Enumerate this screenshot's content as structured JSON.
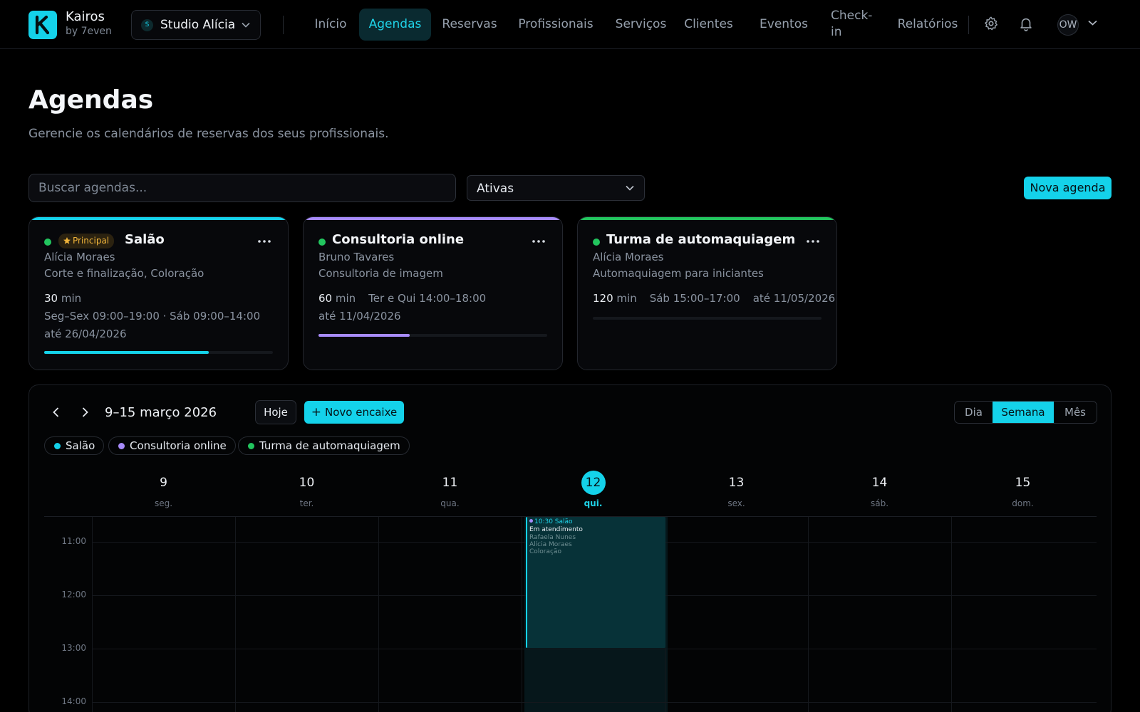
{
  "brand": {
    "name": "Kairos",
    "sub": "by 7even"
  },
  "workspace": {
    "initial": "S",
    "name": "Studio Alícia"
  },
  "nav": {
    "inicio": "Início",
    "agendas": "Agendas",
    "reservas": "Reservas",
    "profissionais": "Profissionais",
    "servicos": "Serviços",
    "clientes": "Clientes",
    "eventos": "Eventos",
    "checkin_1": "Check-",
    "checkin_2": "in",
    "relatorios": "Relatórios"
  },
  "user": {
    "initials": "OW"
  },
  "page": {
    "title": "Agendas",
    "subtitle": "Gerencie os calendários de reservas dos seus profissionais."
  },
  "filters": {
    "search_placeholder": "Buscar agendas...",
    "status_value": "Ativas",
    "new_button": "Nova agenda"
  },
  "cards": [
    {
      "accent": "#14d2ea",
      "badge": "Principal",
      "title": "Salão",
      "professional": "Alícia Moraes",
      "services": "Corte e finalização, Coloração",
      "duration": "30",
      "duration_unit": "min",
      "schedule": "Seg–Sex 09:00–19:00 · Sáb 09:00–14:00",
      "until": "até 26/04/2026",
      "progress": 0.72
    },
    {
      "accent": "#a78bfa",
      "title": "Consultoria online",
      "professional": "Bruno Tavares",
      "services": "Consultoria de imagem",
      "duration": "60",
      "duration_unit": "min",
      "schedule": "Ter e Qui 14:00–18:00",
      "until": "até 11/04/2026",
      "progress": 0.4
    },
    {
      "accent": "#22c55e",
      "title": "Turma de automaquiagem",
      "professional": "Alícia Moraes",
      "services": "Automaquiagem para iniciantes",
      "duration": "120",
      "duration_unit": "min",
      "schedule": "Sáb 15:00–17:00",
      "until": "até 11/05/2026",
      "progress": 0
    }
  ],
  "calendar": {
    "range": "9–15 março 2026",
    "today_button": "Hoje",
    "new_slot_button": "Novo encaixe",
    "views": {
      "day": "Dia",
      "week": "Semana",
      "month": "Mês",
      "selected": "Semana"
    },
    "legend": [
      {
        "label": "Salão",
        "color": "#14d2ea"
      },
      {
        "label": "Consultoria online",
        "color": "#a78bfa"
      },
      {
        "label": "Turma de automaquiagem",
        "color": "#22c55e"
      }
    ],
    "days": [
      {
        "num": "9",
        "name": "seg."
      },
      {
        "num": "10",
        "name": "ter."
      },
      {
        "num": "11",
        "name": "qua."
      },
      {
        "num": "12",
        "name": "qui.",
        "today": true
      },
      {
        "num": "13",
        "name": "sex."
      },
      {
        "num": "14",
        "name": "sáb."
      },
      {
        "num": "15",
        "name": "dom."
      }
    ],
    "hours": [
      "11:00",
      "12:00",
      "13:00",
      "14:00"
    ],
    "event": {
      "time": "10:30 Salão",
      "status": "Em atendimento",
      "client": "Rafaela Nunes",
      "professional": "Alícia Moraes",
      "service": "Coloração"
    }
  }
}
